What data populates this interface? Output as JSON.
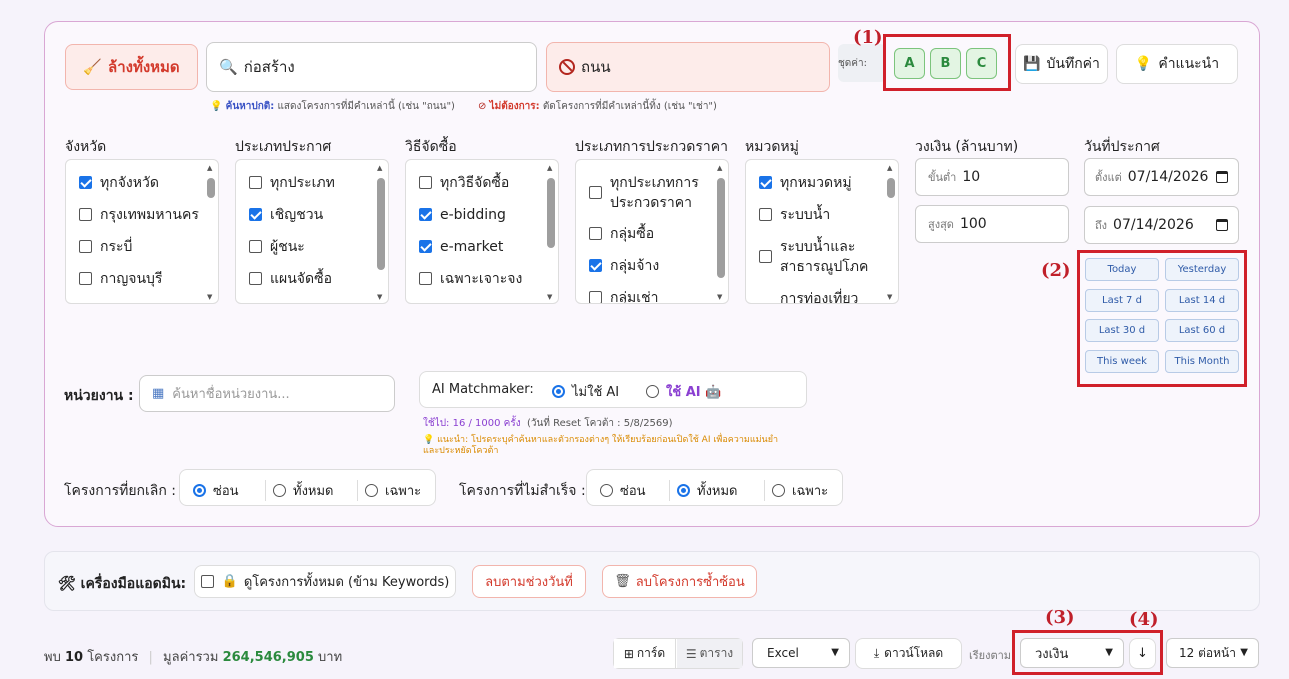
{
  "search": {
    "clear_all": "ล้างทั้งหมด",
    "keyword_value": "ก่อสร้าง",
    "exclude_value": "ถนน",
    "hint_normal_label": "ค้นหาปกติ:",
    "hint_normal_text": "แสดงโครงการที่มีคำเหล่านี้ (เช่น \"ถนน\")",
    "hint_exclude_label": "ไม่ต้องการ:",
    "hint_exclude_text": "ตัดโครงการที่มีคำเหล่านี้ทิ้ง (เช่น \"เช่า\")"
  },
  "presets": {
    "label": "ชุดค่า:",
    "items": [
      "A",
      "B",
      "C"
    ],
    "save": "บันทึกค่า",
    "advice": "คำแนะนำ"
  },
  "annotations": [
    "(1)",
    "(2)",
    "(3)",
    "(4)"
  ],
  "filters": {
    "province": {
      "label": "จังหวัด",
      "items": [
        "ทุกจังหวัด",
        "กรุงเทพมหานคร",
        "กระบี่",
        "กาญจนบุรี"
      ],
      "checked": [
        true,
        false,
        false,
        false
      ]
    },
    "announce_type": {
      "label": "ประเภทประกาศ",
      "items": [
        "ทุกประเภท",
        "เชิญชวน",
        "ผู้ชนะ",
        "แผนจัดซื้อ"
      ],
      "checked": [
        false,
        true,
        false,
        false
      ]
    },
    "method": {
      "label": "วิธีจัดซื้อ",
      "items": [
        "ทุกวิธีจัดซื้อ",
        "e-bidding",
        "e-market",
        "เฉพาะเจาะจง"
      ],
      "checked": [
        false,
        true,
        true,
        false
      ]
    },
    "bid_type": {
      "label": "ประเภทการประกวดราคา",
      "items": [
        "ทุกประเภทการ",
        "ประกวดราคา",
        "กลุ่มซื้อ",
        "กลุ่มจ้าง",
        "กลุ่มเช่า"
      ],
      "checked": [
        false,
        false,
        true,
        false
      ]
    },
    "category": {
      "label": "หมวดหมู่",
      "items": [
        "ทุกหมวดหมู่",
        "ระบบน้ำ",
        "ระบบน้ำและ",
        "สาธารณูปโภค",
        "การท่องเที่ยว"
      ],
      "checked": [
        true,
        false,
        false
      ]
    },
    "budget": {
      "label": "วงเงิน (ล้านบาท)",
      "min_prefix": "ขั้นต่ำ",
      "min_value": "10",
      "max_prefix": "สูงสุด",
      "max_value": "100"
    },
    "date": {
      "label": "วันที่ประกาศ",
      "from_prefix": "ตั้งแต่",
      "from_value": "07/14/2026",
      "to_prefix": "ถึง",
      "to_value": "07/14/2026"
    }
  },
  "quick_dates": [
    "Today",
    "Yesterday",
    "Last 7 d",
    "Last 14 d",
    "Last 30 d",
    "Last 60 d",
    "This week",
    "This Month"
  ],
  "agency": {
    "label": "หน่วยงาน :",
    "placeholder": "ค้นหาชื่อหน่วยงาน..."
  },
  "ai": {
    "label": "AI Matchmaker:",
    "opt_off": "ไม่ใช้ AI",
    "opt_on": "ใช้ AI",
    "usage": "ใช้ไป: 16 / 1000 ครั้ง",
    "reset": "(วันที่ Reset โควต้า : 5/8/2569)",
    "tip_line1": "แนะนำ: โปรดระบุคำค้นหาและตัวกรองต่างๆ ให้เรียบร้อยก่อนเปิดใช้ AI เพื่อความแม่นยำ",
    "tip_line2": "และประหยัดโควต้า"
  },
  "cancelled": {
    "label": "โครงการที่ยกเลิก :",
    "options": [
      "ซ่อน",
      "ทั้งหมด",
      "เฉพาะ"
    ],
    "selected": 0
  },
  "unsuccessful": {
    "label": "โครงการที่ไม่สำเร็จ :",
    "options": [
      "ซ่อน",
      "ทั้งหมด",
      "เฉพาะ"
    ],
    "selected": 1
  },
  "admin": {
    "label": "เครื่องมือแอดมิน:",
    "view_all": "ดูโครงการทั้งหมด (ข้าม Keywords)",
    "delete_range": "ลบตามช่วงวันที่",
    "delete_dup": "ลบโครงการซ้ำซ้อน"
  },
  "results": {
    "found_prefix": "พบ",
    "count": "10",
    "found_suffix": "โครงการ",
    "total_label": "มูลค่ารวม",
    "total_value": "264,546,905",
    "currency": "บาท",
    "view_card": "การ์ด",
    "view_table": "ตาราง",
    "export_format": "Excel",
    "download": "ดาวน์โหลด",
    "sort_label": "เรียงตาม",
    "sort_value": "วงเงิน",
    "sort_dir": "↓",
    "per_page": "12 ต่อหน้า"
  },
  "colors": {
    "accent": "#1a73e8",
    "danger": "#d33a2c",
    "annotation": "#d0202a",
    "preset_green": "#2b8a3e"
  }
}
